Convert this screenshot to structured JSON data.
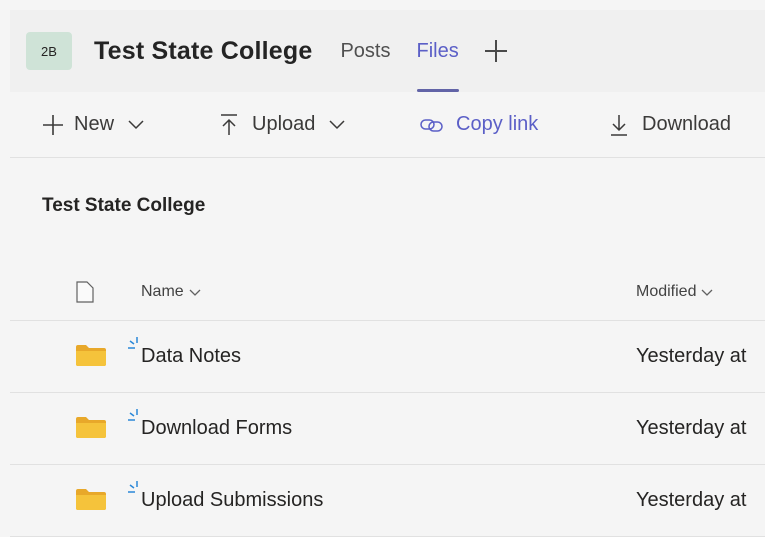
{
  "header": {
    "avatar_initials": "2B",
    "team_name": "Test State College",
    "tabs": [
      {
        "label": "Posts",
        "active": false
      },
      {
        "label": "Files",
        "active": true
      }
    ],
    "add_tab_icon": "plus-icon"
  },
  "toolbar": {
    "new_label": "New",
    "upload_label": "Upload",
    "copy_link_label": "Copy link",
    "download_label": "Download"
  },
  "section_title": "Test State College",
  "columns": {
    "name": "Name",
    "modified": "Modified"
  },
  "files": [
    {
      "name": "Data Notes",
      "modified": "Yesterday at"
    },
    {
      "name": "Download Forms",
      "modified": "Yesterday at"
    },
    {
      "name": "Upload Submissions",
      "modified": "Yesterday at"
    }
  ],
  "colors": {
    "accent": "#5b5fc7",
    "folder": "#f5c33b",
    "sync": "#2b88d8",
    "avatar_bg": "#cfe3d7"
  }
}
